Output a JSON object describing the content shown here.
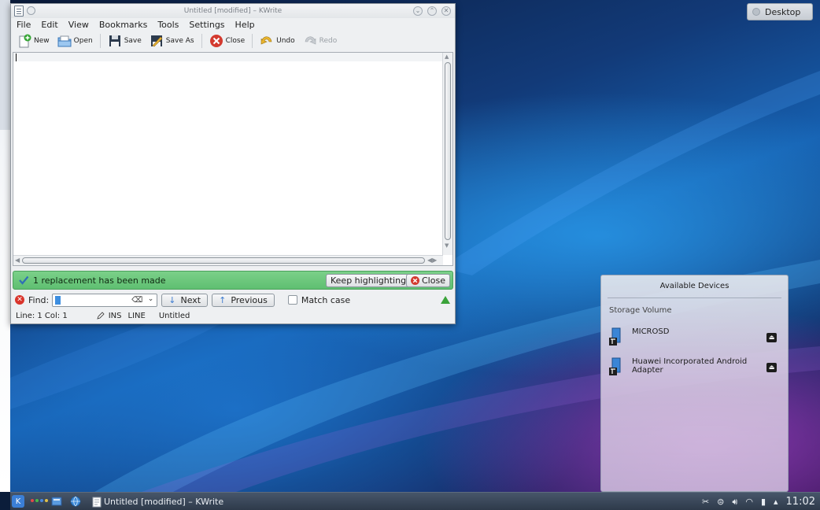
{
  "desktop": {
    "toolbox_label": "Desktop"
  },
  "window": {
    "title": "Untitled [modified] – KWrite",
    "menu": [
      "File",
      "Edit",
      "View",
      "Bookmarks",
      "Tools",
      "Settings",
      "Help"
    ],
    "toolbar": {
      "new": "New",
      "open": "Open",
      "save": "Save",
      "save_as": "Save As",
      "close": "Close",
      "undo": "Undo",
      "redo": "Redo"
    },
    "notification": {
      "message": "1 replacement has been made",
      "keep_highlighting": "Keep highlighting",
      "close": "Close"
    },
    "find": {
      "label": "Find:",
      "value": "",
      "next": "Next",
      "previous": "Previous",
      "match_case": "Match case"
    },
    "status": {
      "position": "Line: 1 Col: 1",
      "mode": "INS",
      "select_mode": "LINE",
      "document": "Untitled"
    }
  },
  "devices": {
    "title": "Available Devices",
    "section": "Storage Volume",
    "items": [
      {
        "name": "MICROSD"
      },
      {
        "name": "Huawei Incorporated Android Adapter"
      }
    ]
  },
  "taskbar": {
    "task_label": "Untitled [modified] – KWrite",
    "clock": "11:02"
  },
  "colors": {
    "notification_bg": "#66c477",
    "find_close": "#d9342b",
    "accent": "#3d8ee0",
    "taskbar": "#3a4758"
  }
}
